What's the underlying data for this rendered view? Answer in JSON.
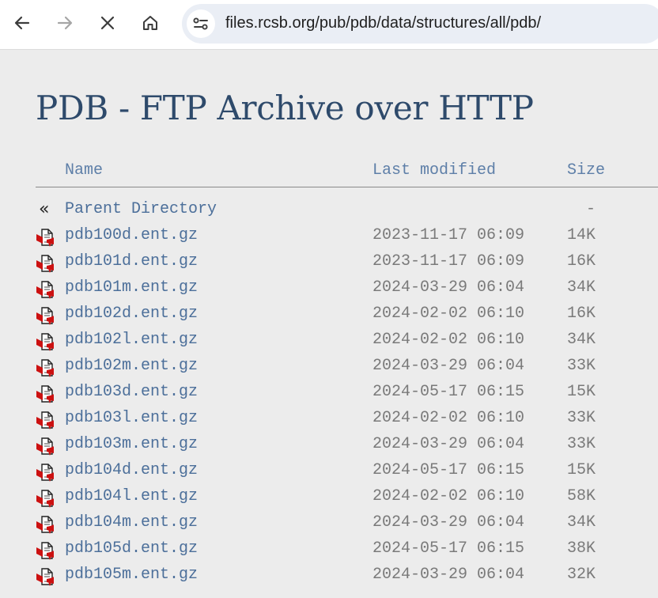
{
  "browser": {
    "url": "files.rcsb.org/pub/pdb/data/structures/all/pdb/",
    "icons": {
      "back": "back-arrow-icon",
      "forward": "forward-arrow-icon",
      "stop": "close-icon",
      "home": "home-icon",
      "site_info": "site-info-icon"
    }
  },
  "page": {
    "title": "PDB - FTP Archive over HTTP"
  },
  "listing": {
    "headers": {
      "name": "Name",
      "modified": "Last modified",
      "size": "Size"
    },
    "parent": {
      "glyph": "«",
      "name": "Parent Directory",
      "modified": "",
      "size": "-"
    },
    "files": [
      {
        "name": "pdb100d.ent.gz",
        "modified": "2023-11-17 06:09",
        "size": "14K"
      },
      {
        "name": "pdb101d.ent.gz",
        "modified": "2023-11-17 06:09",
        "size": "16K"
      },
      {
        "name": "pdb101m.ent.gz",
        "modified": "2024-03-29 06:04",
        "size": "34K"
      },
      {
        "name": "pdb102d.ent.gz",
        "modified": "2024-02-02 06:10",
        "size": "16K"
      },
      {
        "name": "pdb102l.ent.gz",
        "modified": "2024-02-02 06:10",
        "size": "34K"
      },
      {
        "name": "pdb102m.ent.gz",
        "modified": "2024-03-29 06:04",
        "size": "33K"
      },
      {
        "name": "pdb103d.ent.gz",
        "modified": "2024-05-17 06:15",
        "size": "15K"
      },
      {
        "name": "pdb103l.ent.gz",
        "modified": "2024-02-02 06:10",
        "size": "33K"
      },
      {
        "name": "pdb103m.ent.gz",
        "modified": "2024-03-29 06:04",
        "size": "33K"
      },
      {
        "name": "pdb104d.ent.gz",
        "modified": "2024-05-17 06:15",
        "size": "15K"
      },
      {
        "name": "pdb104l.ent.gz",
        "modified": "2024-02-02 06:10",
        "size": "58K"
      },
      {
        "name": "pdb104m.ent.gz",
        "modified": "2024-03-29 06:04",
        "size": "34K"
      },
      {
        "name": "pdb105d.ent.gz",
        "modified": "2024-05-17 06:15",
        "size": "38K"
      },
      {
        "name": "pdb105m.ent.gz",
        "modified": "2024-03-29 06:04",
        "size": "32K"
      }
    ],
    "file_icon": "compressed-file-icon"
  },
  "colors": {
    "title": "#2e4a6b",
    "link": "#4c6f9a",
    "meta": "#7a7a7a",
    "background": "#ececec",
    "icon_red": "#cc1111"
  }
}
